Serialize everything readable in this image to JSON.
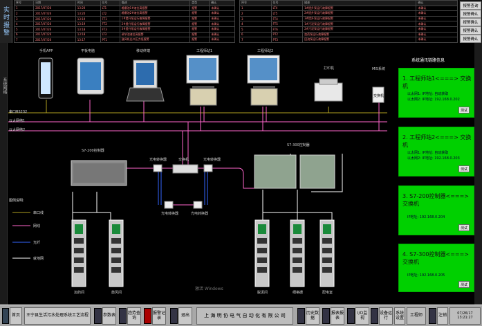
{
  "alarm_panel": {
    "side_label": "实时报警",
    "table1_headers": [
      "序号",
      "日期",
      "时间",
      "位号",
      "描述",
      "类型",
      "确认"
    ],
    "table1_rows": [
      [
        "1",
        "2017/07/26",
        "13:20",
        "LT1",
        "格栅池1#液位高报警",
        "报警",
        "未确认"
      ],
      [
        "2",
        "2017/07/26",
        "13:20",
        "LT2",
        "格栅池2#液位高报警",
        "报警",
        "未确认"
      ],
      [
        "3",
        "2017/07/26",
        "13:19",
        "FT1",
        "1#提升泵运行故障报警",
        "报警",
        "未确认"
      ],
      [
        "4",
        "2017/07/26",
        "13:19",
        "FT2",
        "2#提升泵运行故障报警",
        "报警",
        "未确认"
      ],
      [
        "5",
        "2017/07/26",
        "13:18",
        "FT3",
        "3#提升泵运行故障报警",
        "报警",
        "未确认"
      ],
      [
        "6",
        "2017/07/26",
        "13:18",
        "LT3",
        "调节池液位高报警",
        "报警",
        "未确认"
      ],
      [
        "7",
        "2017/07/26",
        "13:17",
        "PT1",
        "鼓风机出口压力低报警",
        "报警",
        "未确认"
      ]
    ],
    "table2_headers": [
      "序号",
      "位号",
      "描述",
      "确认"
    ],
    "table2_rows": [
      [
        "1",
        "LT4",
        "1#提升泵运行故障报警",
        "未确认"
      ],
      [
        "2",
        "LT5",
        "2#提升泵运行故障报警",
        "未确认"
      ],
      [
        "3",
        "FT4",
        "3#提升泵运行故障报警",
        "未确认"
      ],
      [
        "4",
        "FT5",
        "1#污泥泵运行故障报警",
        "未确认"
      ],
      [
        "5",
        "FT6",
        "2#污泥泵运行故障报警",
        "未确认"
      ],
      [
        "6",
        "PT2",
        "加药泵运行故障报警",
        "未确认"
      ],
      [
        "7",
        "PT3",
        "回流泵运行故障报警",
        "未确认"
      ]
    ],
    "right_buttons": [
      "报警查询",
      "报警确认",
      "报警确认",
      "报警确认",
      "报警确认"
    ]
  },
  "left_strip_label": "系统网络",
  "devices": {
    "mobile": "手机APP",
    "tablet": "平板电脑",
    "laptop": "移动终端",
    "ws1": "工程师站1",
    "ws2": "工程师站2",
    "printer": "打印机",
    "mis": "MIS系统",
    "mis_box": "交换机",
    "plc200": "S7-200控制器",
    "plc300": "S7-300控制器",
    "switch": "交换机",
    "fiber1": "光电转换器",
    "fiber2": "光电转换器",
    "fiber3": "光电转换器",
    "fiber4": "光电转换器",
    "cab1": "加药间",
    "cab2": "鼓风间",
    "cab3": "脱泥间",
    "cab4": "细格栅",
    "cab5": "配电室"
  },
  "networks": [
    "串口RS232",
    "以太网络1",
    "以太网络2"
  ],
  "legend": {
    "title": "图例说明:",
    "items": [
      {
        "label": "串口线",
        "color": "#b0a020"
      },
      {
        "label": "网线",
        "color": "#ff66cc"
      },
      {
        "label": "光纤",
        "color": "#3366ff"
      },
      {
        "label": "就地网",
        "color": "#ffffff"
      }
    ]
  },
  "info_panel": {
    "title": "系统通讯链路信息",
    "boxes": [
      {
        "title": "1. 工程师站1<===> 交换机",
        "line1": "以太网1: IP地址: 自动获取",
        "line2": "以太网2: IP地址: 192.168.0.202",
        "button": "测试"
      },
      {
        "title": "2. 工程师站2<===> 交换机",
        "line1": "以太网1: IP地址: 自动获取",
        "line2": "以太网2: IP地址: 192.168.0.203",
        "button": "测试"
      },
      {
        "title": "3. S7-200控制器<===> 交换机",
        "line1": "",
        "line2": "IP地址: 192.168.0.204",
        "button": "测试"
      },
      {
        "title": "4. S7-300控制器<===> 交换机",
        "line1": "",
        "line2": "IP地址: 192.168.0.205",
        "button": "测试"
      }
    ]
  },
  "watermark": "激活 Windows",
  "bottom_bar": {
    "home": "首页",
    "title_btn": "王宁县生活污水处理系统工艺流程",
    "params": "参数表",
    "trend": "趋势查询",
    "alarm": "报警记录",
    "exit": "退出",
    "company": "上 海 明 协 电 气 自 动 化 有 限 公 司",
    "history": "历史数据",
    "report": "报表报表",
    "io": "I/O监视",
    "device": "设备运行",
    "sys": "系统设置",
    "user": "工程师",
    "logout": "注销",
    "datetime": "07/26/17 13:21:27"
  },
  "colors": {
    "bus_yellow": "#b0a020",
    "bus_pink": "#ff66cc",
    "fiber_blue": "#3366ff",
    "info_green": "#00d000"
  }
}
